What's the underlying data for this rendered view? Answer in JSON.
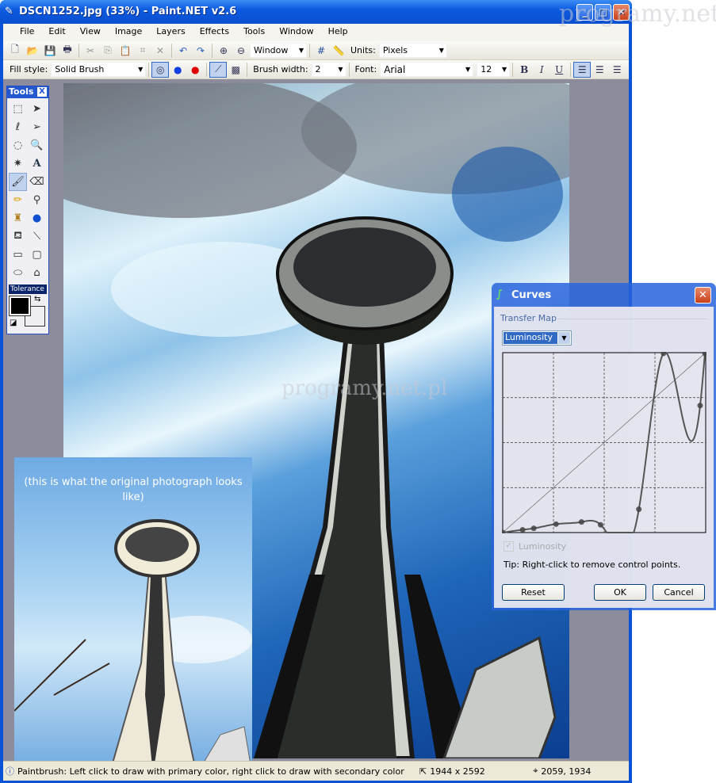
{
  "window": {
    "title": "DSCN1252.jpg (33%) - Paint.NET v2.6",
    "minimize": "_",
    "maximize": "□",
    "close": "✕"
  },
  "menu": [
    "File",
    "Edit",
    "View",
    "Image",
    "Layers",
    "Effects",
    "Tools",
    "Window",
    "Help"
  ],
  "toolbar1": {
    "zoom_value": "Window",
    "units_label": "Units:",
    "units_value": "Pixels"
  },
  "toolbar2": {
    "fill_style_label": "Fill style:",
    "fill_style_value": "Solid Brush",
    "brush_width_label": "Brush width:",
    "brush_width_value": "2",
    "font_label": "Font:",
    "font_value": "Arial",
    "font_size": "12",
    "bold": "B",
    "italic": "I",
    "underline": "U"
  },
  "tools": {
    "title": "Tools",
    "close": "X",
    "tolerance": "Tolerance",
    "primary_color": "#000000",
    "secondary_color": "#ffffff",
    "items": [
      "rectangle-select",
      "move-selection",
      "lasso-select",
      "move-selection-outline",
      "ellipse-select",
      "zoom",
      "magic-wand",
      "text",
      "paintbrush",
      "eraser",
      "pencil",
      "color-picker",
      "clone-stamp",
      "recolor",
      "paint-bucket",
      "line-curve",
      "rectangle",
      "rounded-rectangle",
      "ellipse",
      "freeform-shape"
    ],
    "selected": "paintbrush"
  },
  "inset": {
    "caption": "(this is what the original photograph looks like)"
  },
  "status": {
    "message": "Paintbrush: Left click to draw with primary color, right click to draw with secondary color",
    "image_size": "1944 x 2592",
    "cursor_position": "2059, 1934"
  },
  "curves": {
    "title": "Curves",
    "section": "Transfer Map",
    "mode": "Luminosity",
    "checkbox_label": "Luminosity",
    "checkbox_checked": true,
    "tip": "Tip: Right-click to remove control points.",
    "reset": "Reset",
    "ok": "OK",
    "cancel": "Cancel",
    "control_points": [
      [
        0,
        0
      ],
      [
        25,
        4
      ],
      [
        39,
        6
      ],
      [
        67,
        12
      ],
      [
        99,
        15
      ],
      [
        123,
        11
      ],
      [
        171,
        33
      ],
      [
        202,
        254
      ],
      [
        248,
        180
      ],
      [
        254,
        254
      ]
    ]
  },
  "watermark": "programy.net.pl"
}
